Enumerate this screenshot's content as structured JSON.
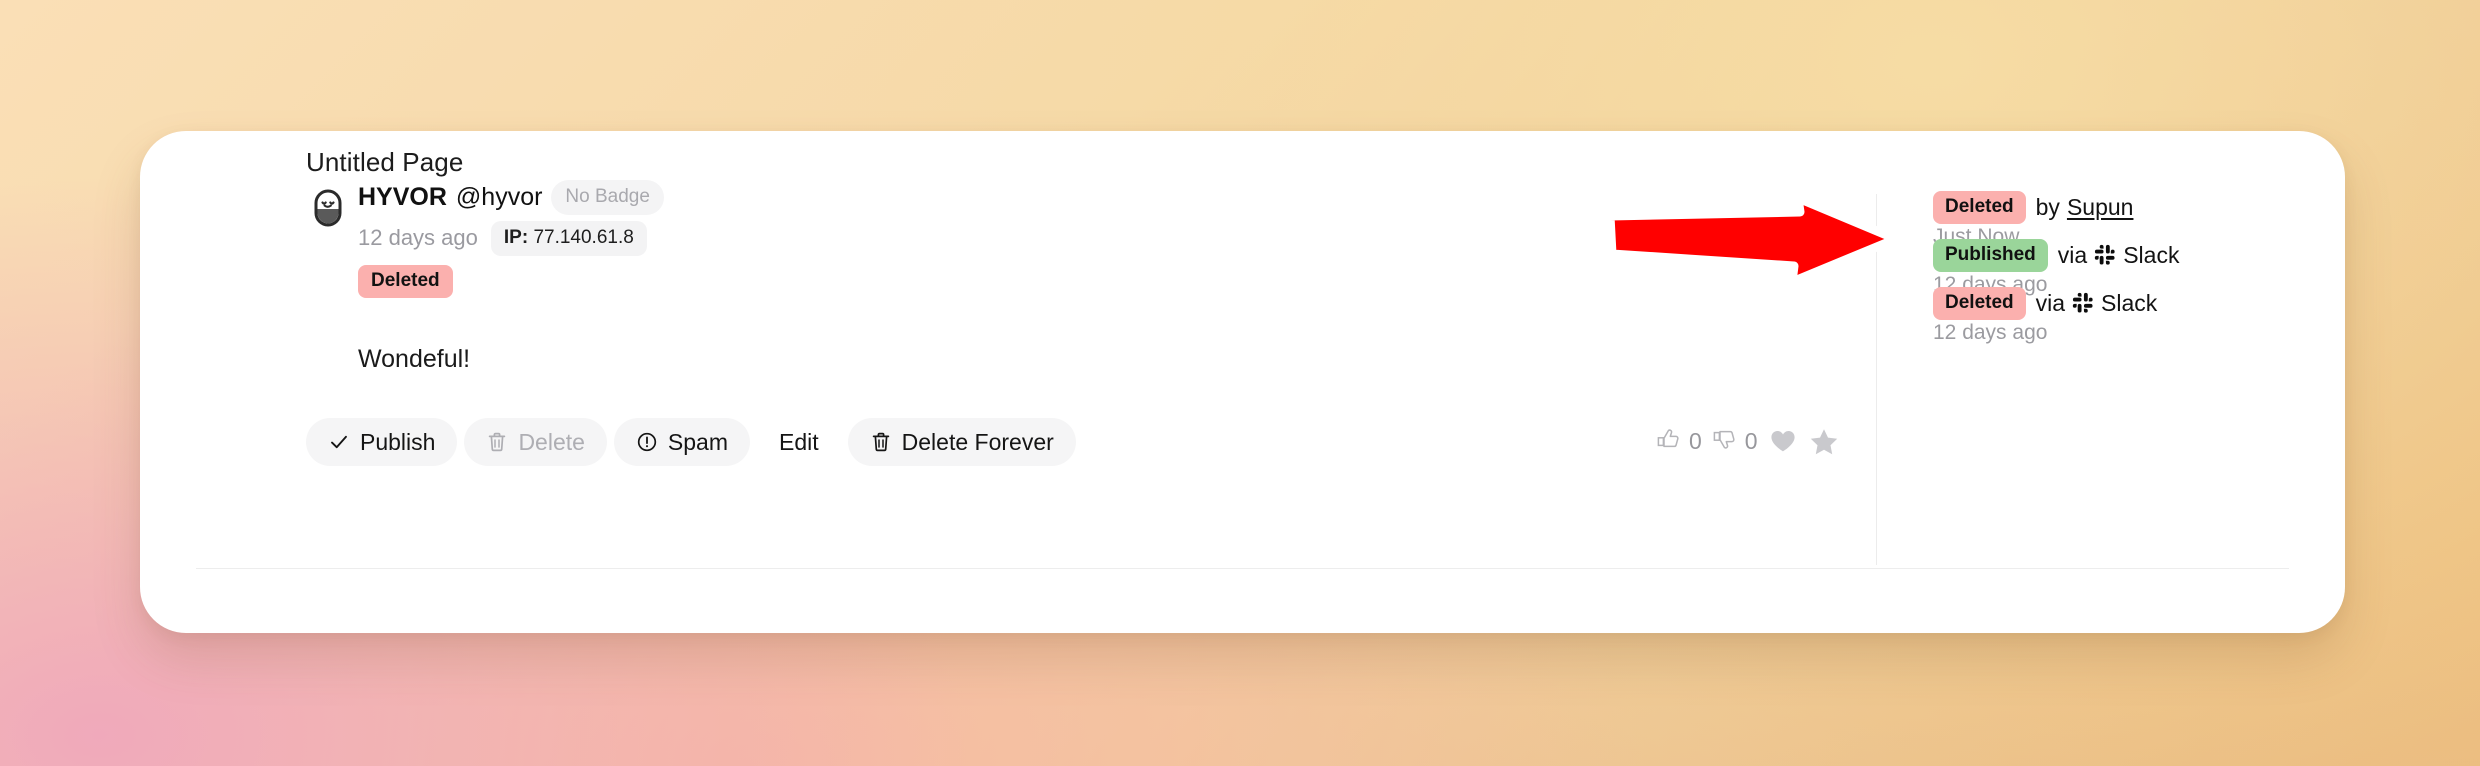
{
  "page": {
    "title": "Untitled Page"
  },
  "comment": {
    "author_name": "HYVOR",
    "author_handle": "@hyvor",
    "badge_label": "No Badge",
    "time_label": "12 days ago",
    "ip_label_prefix": "IP:",
    "ip_address": "77.140.61.8",
    "status_label": "Deleted",
    "body": "Wondeful!",
    "avatar_icon": "user-avatar-icon"
  },
  "actions": [
    {
      "id": "publish",
      "label": "Publish",
      "icon": "check-icon",
      "state": "enabled",
      "style": "pill"
    },
    {
      "id": "delete",
      "label": "Delete",
      "icon": "trash-icon",
      "state": "disabled",
      "style": "pill"
    },
    {
      "id": "spam",
      "label": "Spam",
      "icon": "alert-circle-icon",
      "state": "enabled",
      "style": "pill"
    },
    {
      "id": "edit",
      "label": "Edit",
      "icon": "",
      "state": "enabled",
      "style": "plain"
    },
    {
      "id": "delete-forever",
      "label": "Delete Forever",
      "icon": "trash-icon",
      "state": "enabled",
      "style": "pill"
    }
  ],
  "reactions": {
    "like_icon": "thumbs-up-icon",
    "like_count": "0",
    "dislike_icon": "thumbs-down-icon",
    "dislike_count": "0",
    "heart_icon": "heart-icon",
    "star_icon": "star-icon"
  },
  "activity": [
    {
      "chip": "Deleted",
      "chip_type": "deleted",
      "connector": "by",
      "source": "Supun",
      "source_is_link": true,
      "source_icon": "",
      "time": "Just Now"
    },
    {
      "chip": "Published",
      "chip_type": "published",
      "connector": "via",
      "source": "Slack",
      "source_is_link": false,
      "source_icon": "slack-icon",
      "time": "12 days ago"
    },
    {
      "chip": "Deleted",
      "chip_type": "deleted",
      "connector": "via",
      "source": "Slack",
      "source_is_link": false,
      "source_icon": "slack-icon",
      "time": "12 days ago"
    }
  ],
  "annotation": {
    "type": "arrow",
    "direction": "right",
    "color": "#FF0000",
    "outline_color": "#FFFFFF",
    "points_at": "activity-item-0"
  },
  "colors": {
    "card_background": "#FFFFFF",
    "badge_deleted": "#FBB0AE",
    "badge_published": "#9AD59A",
    "pill_background": "#F4F4F5",
    "muted_text": "#9A9AA0",
    "annotation_red": "#FF0000"
  }
}
